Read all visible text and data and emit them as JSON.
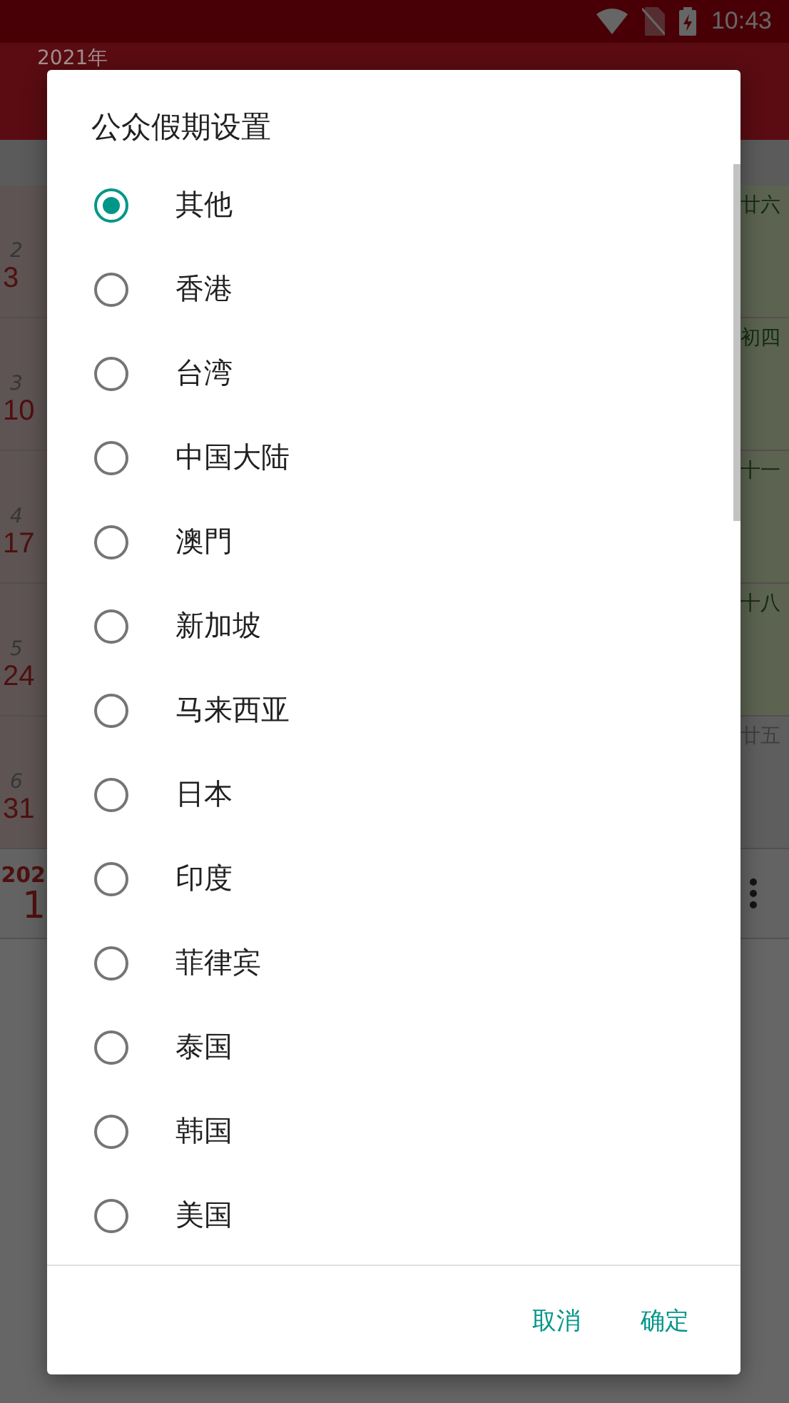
{
  "status_bar": {
    "time": "10:43"
  },
  "app_bar": {
    "title": "2021年"
  },
  "calendar": {
    "weeks": [
      {
        "week": "2",
        "day": "3",
        "lunar": "廿六",
        "highlighted": true
      },
      {
        "week": "3",
        "day": "10",
        "lunar": "初四",
        "highlighted": true
      },
      {
        "week": "4",
        "day": "17",
        "lunar": "十一",
        "highlighted": true
      },
      {
        "week": "5",
        "day": "24",
        "lunar": "十八",
        "highlighted": true
      },
      {
        "week": "6",
        "day": "31",
        "lunar": "廿五",
        "highlighted": false
      }
    ]
  },
  "bottom_row": {
    "year": "202",
    "day": "1"
  },
  "dialog": {
    "title": "公众假期设置",
    "options": [
      {
        "label": "其他",
        "selected": true
      },
      {
        "label": "香港",
        "selected": false
      },
      {
        "label": "台湾",
        "selected": false
      },
      {
        "label": "中国大陆",
        "selected": false
      },
      {
        "label": "澳門",
        "selected": false
      },
      {
        "label": "新加坡",
        "selected": false
      },
      {
        "label": "马来西亚",
        "selected": false
      },
      {
        "label": "日本",
        "selected": false
      },
      {
        "label": "印度",
        "selected": false
      },
      {
        "label": "菲律宾",
        "selected": false
      },
      {
        "label": "泰国",
        "selected": false
      },
      {
        "label": "韩国",
        "selected": false
      },
      {
        "label": "美国",
        "selected": false
      }
    ],
    "buttons": [
      "取消",
      "确定"
    ]
  }
}
